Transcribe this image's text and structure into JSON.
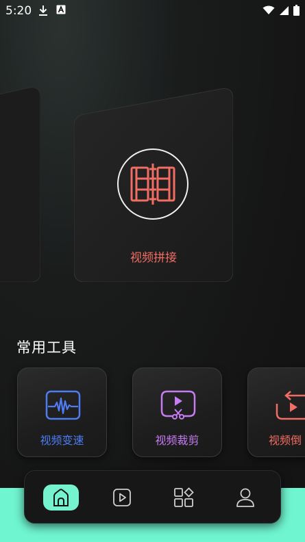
{
  "status_bar": {
    "time": "5:20",
    "left_icons": [
      "download-icon",
      "a-badge-icon"
    ],
    "right_icons": [
      "wifi-icon",
      "signal-icon",
      "battery-icon"
    ]
  },
  "featured": {
    "label": "视频拼接",
    "icon": "film-splice-icon",
    "accent": "#f26d63"
  },
  "section": {
    "title": "常用工具"
  },
  "tools": [
    {
      "label": "视频变速",
      "icon": "waveform-icon",
      "color": "#4f7cf4"
    },
    {
      "label": "视频裁剪",
      "icon": "video-cut-icon",
      "color": "#c77cf3"
    },
    {
      "label": "视频倒",
      "icon": "video-reverse-icon",
      "color": "#f26d63"
    }
  ],
  "nav": {
    "items": [
      {
        "icon": "home-icon",
        "active": true
      },
      {
        "icon": "play-icon",
        "active": false
      },
      {
        "icon": "apps-icon",
        "active": false
      },
      {
        "icon": "profile-icon",
        "active": false
      }
    ],
    "accent": "#75f3cf"
  }
}
